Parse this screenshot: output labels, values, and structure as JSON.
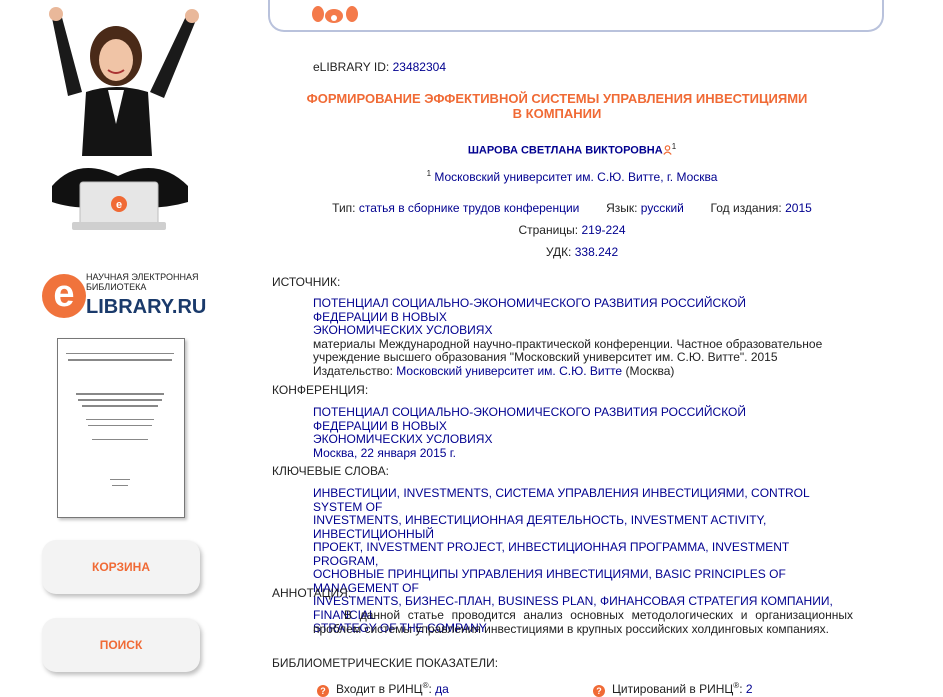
{
  "sidebar": {
    "logo": {
      "letter": "e",
      "tagline": "НАУЧНАЯ ЭЛЕКТРОННАЯ БИБЛИОТЕКА",
      "brand": "LIBRARY.RU"
    },
    "nav": {
      "cart_label": "КОРЗИНА",
      "search_label": "ПОИСК"
    }
  },
  "article": {
    "id_label": "eLIBRARY ID:",
    "id_value": "23482304",
    "title_line1": "ФОРМИРОВАНИЕ ЭФФЕКТИВНОЙ СИСТЕМЫ УПРАВЛЕНИЯ ИНВЕСТИЦИЯМИ",
    "title_line2": "В КОМПАНИИ",
    "author": "ШАРОВА СВЕТЛАНА ВИКТОРОВНА",
    "author_sup": "1",
    "affiliation_sup": "1",
    "affiliation": "Московский университет им. С.Ю. Витте, г. Москва",
    "type_label": "Тип:",
    "type_value": "статья в сборнике трудов конференции",
    "lang_label": "Язык:",
    "lang_value": "русский",
    "year_label": "Год издания:",
    "year_value": "2015",
    "pages_label": "Страницы:",
    "pages_value": "219-224",
    "udc_label": "УДК:",
    "udc_value": "338.242"
  },
  "source": {
    "heading": "ИСТОЧНИК:",
    "title_line1": "ПОТЕНЦИАЛ СОЦИАЛЬНО-ЭКОНОМИЧЕСКОГО РАЗВИТИЯ РОССИЙСКОЙ ФЕДЕРАЦИИ В НОВЫХ",
    "title_line2": "ЭКОНОМИЧЕСКИХ УСЛОВИЯХ",
    "desc_line1": "материалы Международной научно-практической конференции. Частное образовательное",
    "desc_line2": "учреждение высшего образования \"Московский университет им. С.Ю. Витте\". 2015",
    "publisher_label": "Издательство:",
    "publisher_value": "Московский университет им. С.Ю. Витте",
    "publisher_city": "(Москва)"
  },
  "conference": {
    "heading": "КОНФЕРЕНЦИЯ:",
    "title_line1": "ПОТЕНЦИАЛ СОЦИАЛЬНО-ЭКОНОМИЧЕСКОГО РАЗВИТИЯ РОССИЙСКОЙ ФЕДЕРАЦИИ В НОВЫХ",
    "title_line2": "ЭКОНОМИЧЕСКИХ УСЛОВИЯХ",
    "place_date": "Москва, 22 января 2015 г."
  },
  "keywords": {
    "heading": "КЛЮЧЕВЫЕ СЛОВА:",
    "lines": [
      "ИНВЕСТИЦИИ, INVESTMENTS, СИСТЕМА УПРАВЛЕНИЯ ИНВЕСТИЦИЯМИ, CONTROL SYSTEM OF",
      "INVESTMENTS, ИНВЕСТИЦИОННАЯ ДЕЯТЕЛЬНОСТЬ, INVESTMENT ACTIVITY, ИНВЕСТИЦИОННЫЙ",
      "ПРОЕКТ, INVESTMENT PROJECT, ИНВЕСТИЦИОННАЯ ПРОГРАММА, INVESTMENT PROGRAM,",
      "ОСНОВНЫЕ ПРИНЦИПЫ УПРАВЛЕНИЯ ИНВЕСТИЦИЯМИ, BASIC PRINCIPLES OF MANAGEMENT OF",
      "INVESTMENTS, БИЗНЕС-ПЛАН, BUSINESS PLAN, ФИНАНСОВАЯ СТРАТЕГИЯ КОМПАНИИ, FINANCIAL",
      "STRATEGY OF THE COMPANY"
    ]
  },
  "annotation": {
    "heading": "АННОТАЦИЯ:",
    "text": "В данной статье проводится анализ основных методологических и организационных проблем системы управления инвестициями в крупных российских холдинговых компаниях."
  },
  "bibliometrics": {
    "heading": "БИБЛИОМЕТРИЧЕСКИЕ ПОКАЗАТЕЛИ:",
    "help_glyph": "?",
    "rinc_label": "Входит в РИНЦ",
    "rinc_reg": "®",
    "rinc_colon": ":",
    "rinc_value": "да",
    "cites_label": "Цитирований в РИНЦ",
    "cites_reg": "®",
    "cites_colon": ":",
    "cites_value": "2"
  },
  "colors": {
    "accent": "#f06a35",
    "link": "#00008f",
    "brand": "#1a3a6b"
  }
}
